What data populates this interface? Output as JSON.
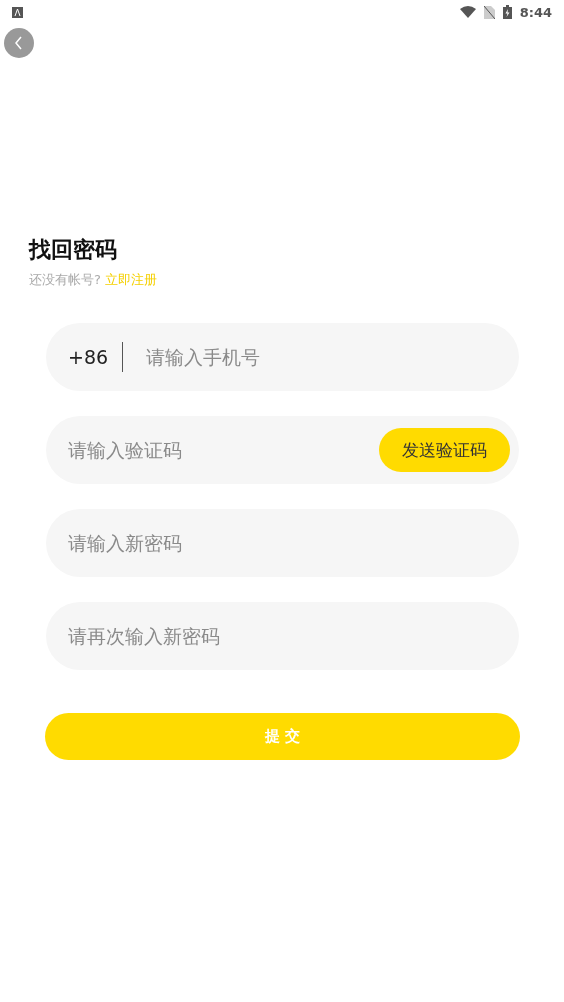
{
  "status_bar": {
    "time": "8:44"
  },
  "title": "找回密码",
  "subtitle": {
    "text": "还没有帐号?",
    "link": "立即注册"
  },
  "fields": [
    {
      "kind": "phone",
      "prefix": "+86",
      "placeholder": "请输入手机号"
    },
    {
      "kind": "code",
      "placeholder": "请输入验证码",
      "button": "发送验证码"
    },
    {
      "kind": "text",
      "placeholder": "请输入新密码"
    },
    {
      "kind": "text",
      "placeholder": "请再次输入新密码"
    }
  ],
  "submit": "提 交"
}
